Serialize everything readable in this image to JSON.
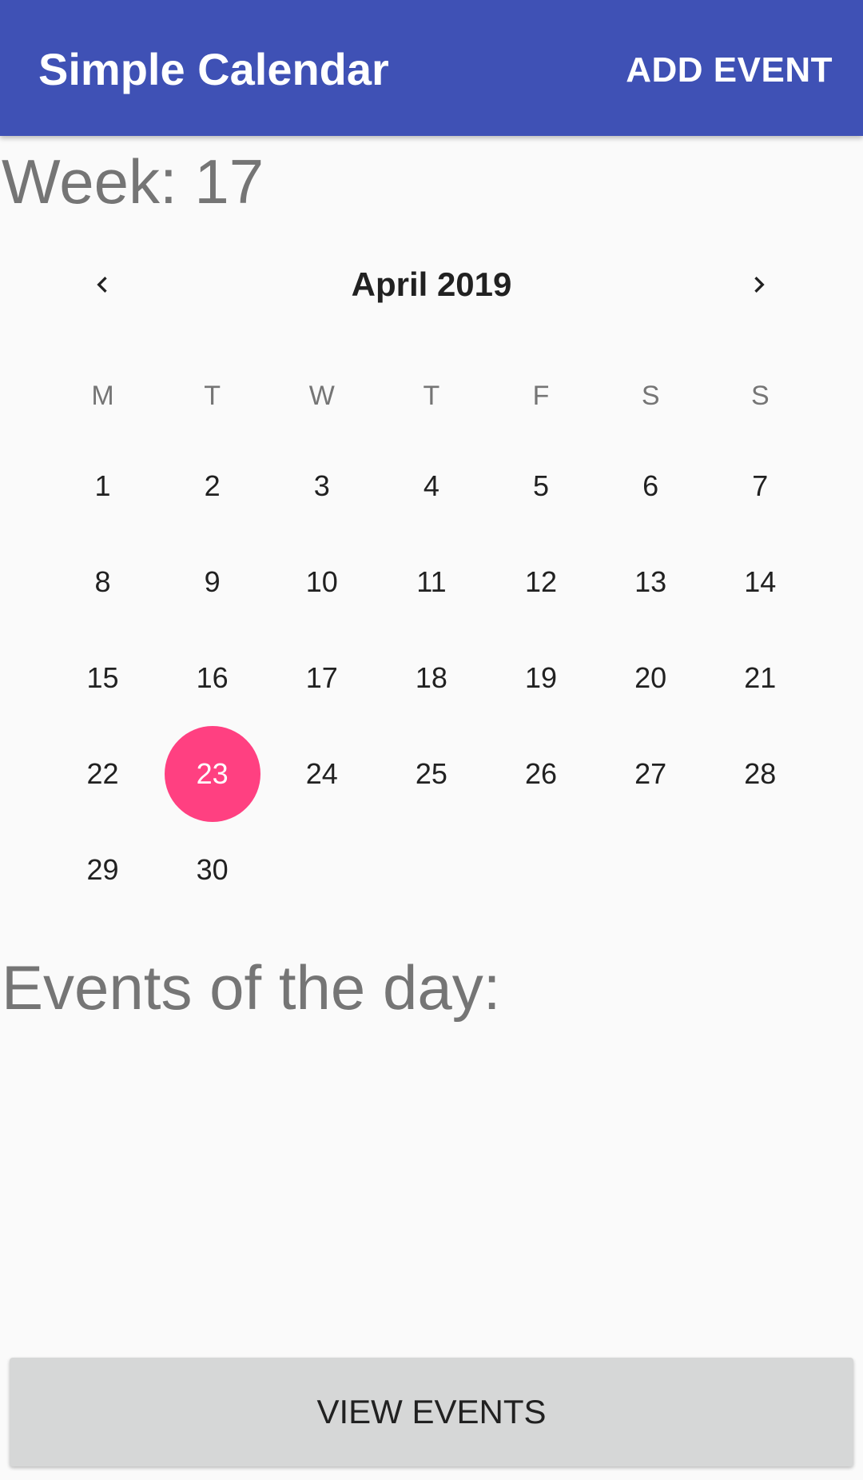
{
  "appbar": {
    "title": "Simple Calendar",
    "action_label": "ADD EVENT"
  },
  "week": {
    "label": "Week: 17"
  },
  "calendar": {
    "month_title": "April 2019",
    "prev_icon": "chevron-left-icon",
    "next_icon": "chevron-right-icon",
    "weekdays": [
      "M",
      "T",
      "W",
      "T",
      "F",
      "S",
      "S"
    ],
    "weeks": [
      [
        "1",
        "2",
        "3",
        "4",
        "5",
        "6",
        "7"
      ],
      [
        "8",
        "9",
        "10",
        "11",
        "12",
        "13",
        "14"
      ],
      [
        "15",
        "16",
        "17",
        "18",
        "19",
        "20",
        "21"
      ],
      [
        "22",
        "23",
        "24",
        "25",
        "26",
        "27",
        "28"
      ],
      [
        "29",
        "30",
        "",
        "",
        "",
        "",
        ""
      ]
    ],
    "selected_day": "23",
    "selected_color": "#ff4081"
  },
  "events": {
    "label": "Events of the day:"
  },
  "footer": {
    "button_label": "VIEW EVENTS"
  },
  "colors": {
    "appbar": "#3f51b5",
    "background": "#fafafa"
  }
}
